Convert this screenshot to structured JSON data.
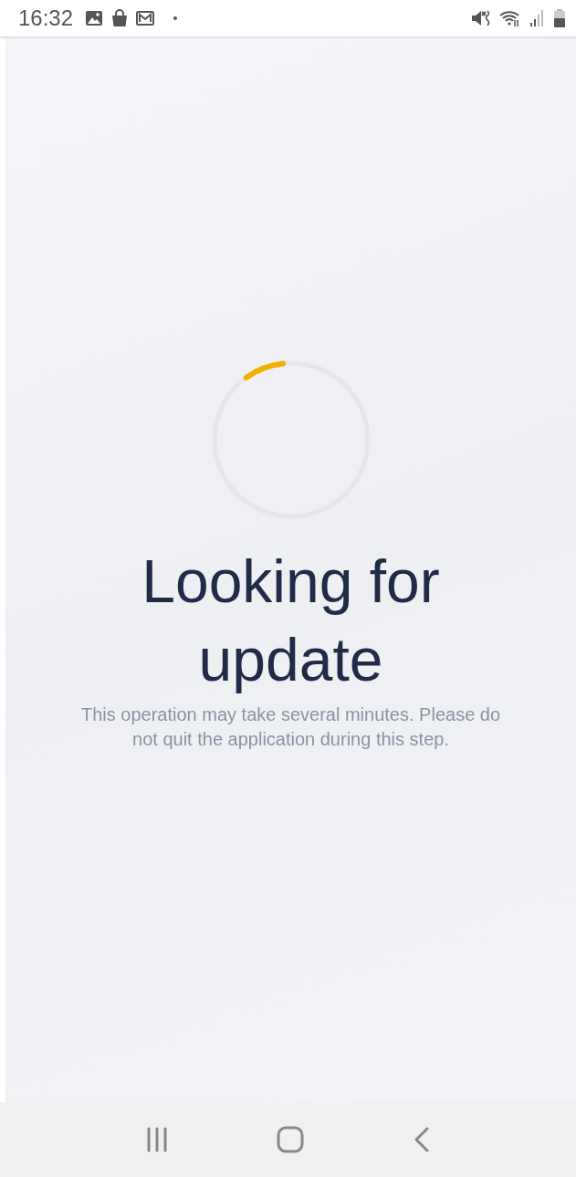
{
  "status_bar": {
    "time": "16:32"
  },
  "title": "Looking for update",
  "message": "This operation may take several minutes. Please do not quit the application during this step."
}
